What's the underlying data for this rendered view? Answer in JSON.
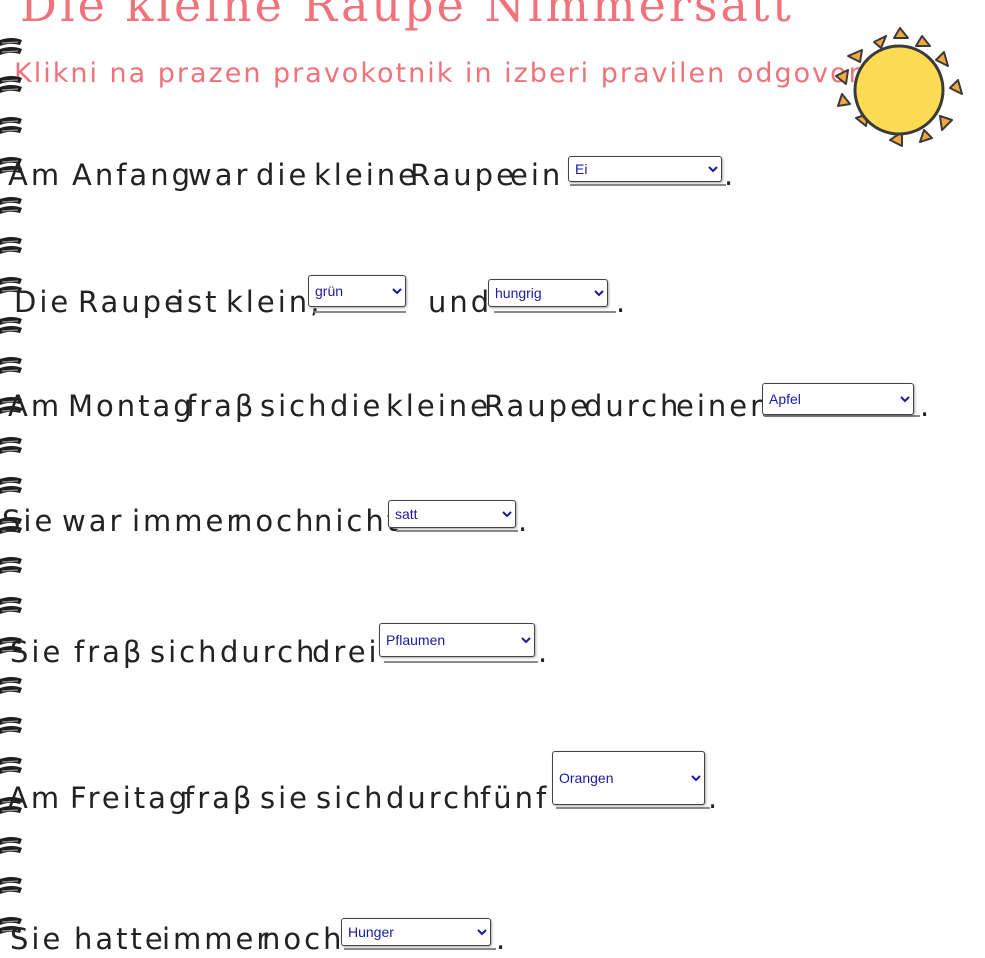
{
  "header": {
    "title": "Die kleine Raupe Nimmersatt",
    "subtitle": "Klikni na prazen pravokotnik in izberi pravilen odgovor."
  },
  "colors": {
    "title": "#f0727a",
    "sun": "#fddb52",
    "sun_rays": "#f6a93b",
    "select_text": "#1a1aa0"
  },
  "sentences": [
    {
      "parts": [
        "Am",
        "Anfang",
        "war",
        "die",
        "kleine",
        "Raupe",
        "ein"
      ],
      "answer": "Ei"
    },
    {
      "parts": [
        "Die",
        "Raupe",
        "ist",
        "klein,"
      ],
      "answer1": "grün",
      "connector": "und",
      "answer2": "hungrig"
    },
    {
      "parts": [
        "Am",
        "Montag",
        "fraβ",
        "sich",
        "die",
        "kleine",
        "Raupe",
        "durch",
        "einen"
      ],
      "answer": "Apfel"
    },
    {
      "parts": [
        "Sie",
        "war",
        "immer",
        "noch",
        "nicht"
      ],
      "answer": "satt"
    },
    {
      "parts": [
        "Sie",
        "fraβ",
        "sich",
        "durch",
        "drei"
      ],
      "answer": "Pflaumen"
    },
    {
      "parts": [
        "Am",
        "Freitag",
        "fraβ",
        "sie",
        "sich",
        "durch",
        "fünf"
      ],
      "answer": "Orangen"
    },
    {
      "parts": [
        "Sie",
        "hatte",
        "immer",
        "noch"
      ],
      "answer": "Hunger"
    }
  ],
  "punctuation": "."
}
